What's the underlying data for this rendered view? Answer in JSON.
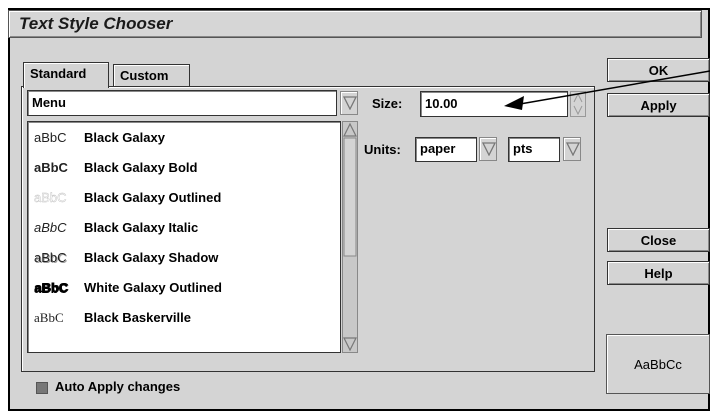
{
  "window": {
    "title": "Text Style Chooser"
  },
  "tabs": [
    {
      "label": "Standard",
      "active": true
    },
    {
      "label": "Custom",
      "active": false
    }
  ],
  "style_field": {
    "value": "Menu"
  },
  "style_list": [
    {
      "sample": "aBbC",
      "name": "Black Galaxy"
    },
    {
      "sample": "aBbC",
      "name": "Black Galaxy Bold"
    },
    {
      "sample": "aBbC",
      "name": "Black Galaxy Outlined"
    },
    {
      "sample": "aBbC",
      "name": "Black Galaxy Italic"
    },
    {
      "sample": "aBbC",
      "name": "Black Galaxy Shadow"
    },
    {
      "sample": "aBbC",
      "name": "White Galaxy Outlined"
    },
    {
      "sample": "aBbC",
      "name": "Black Baskerville"
    }
  ],
  "size": {
    "label": "Size:",
    "value": "10.00"
  },
  "units": {
    "label": "Units:",
    "unit1": "paper",
    "unit2": "pts"
  },
  "buttons": {
    "ok": "OK",
    "apply": "Apply",
    "close": "Close",
    "help": "Help"
  },
  "preview": {
    "text": "AaBbCc"
  },
  "auto_apply": {
    "label": "Auto Apply changes",
    "checked": true
  },
  "colors": {
    "window_bg": "#d4d4d4",
    "field_bg": "#ffffff"
  },
  "icons": {
    "dropdown": "dropdown-triangle-icon",
    "spinner": "spinner-arrows-icon",
    "annotation": "annotation-arrow"
  }
}
